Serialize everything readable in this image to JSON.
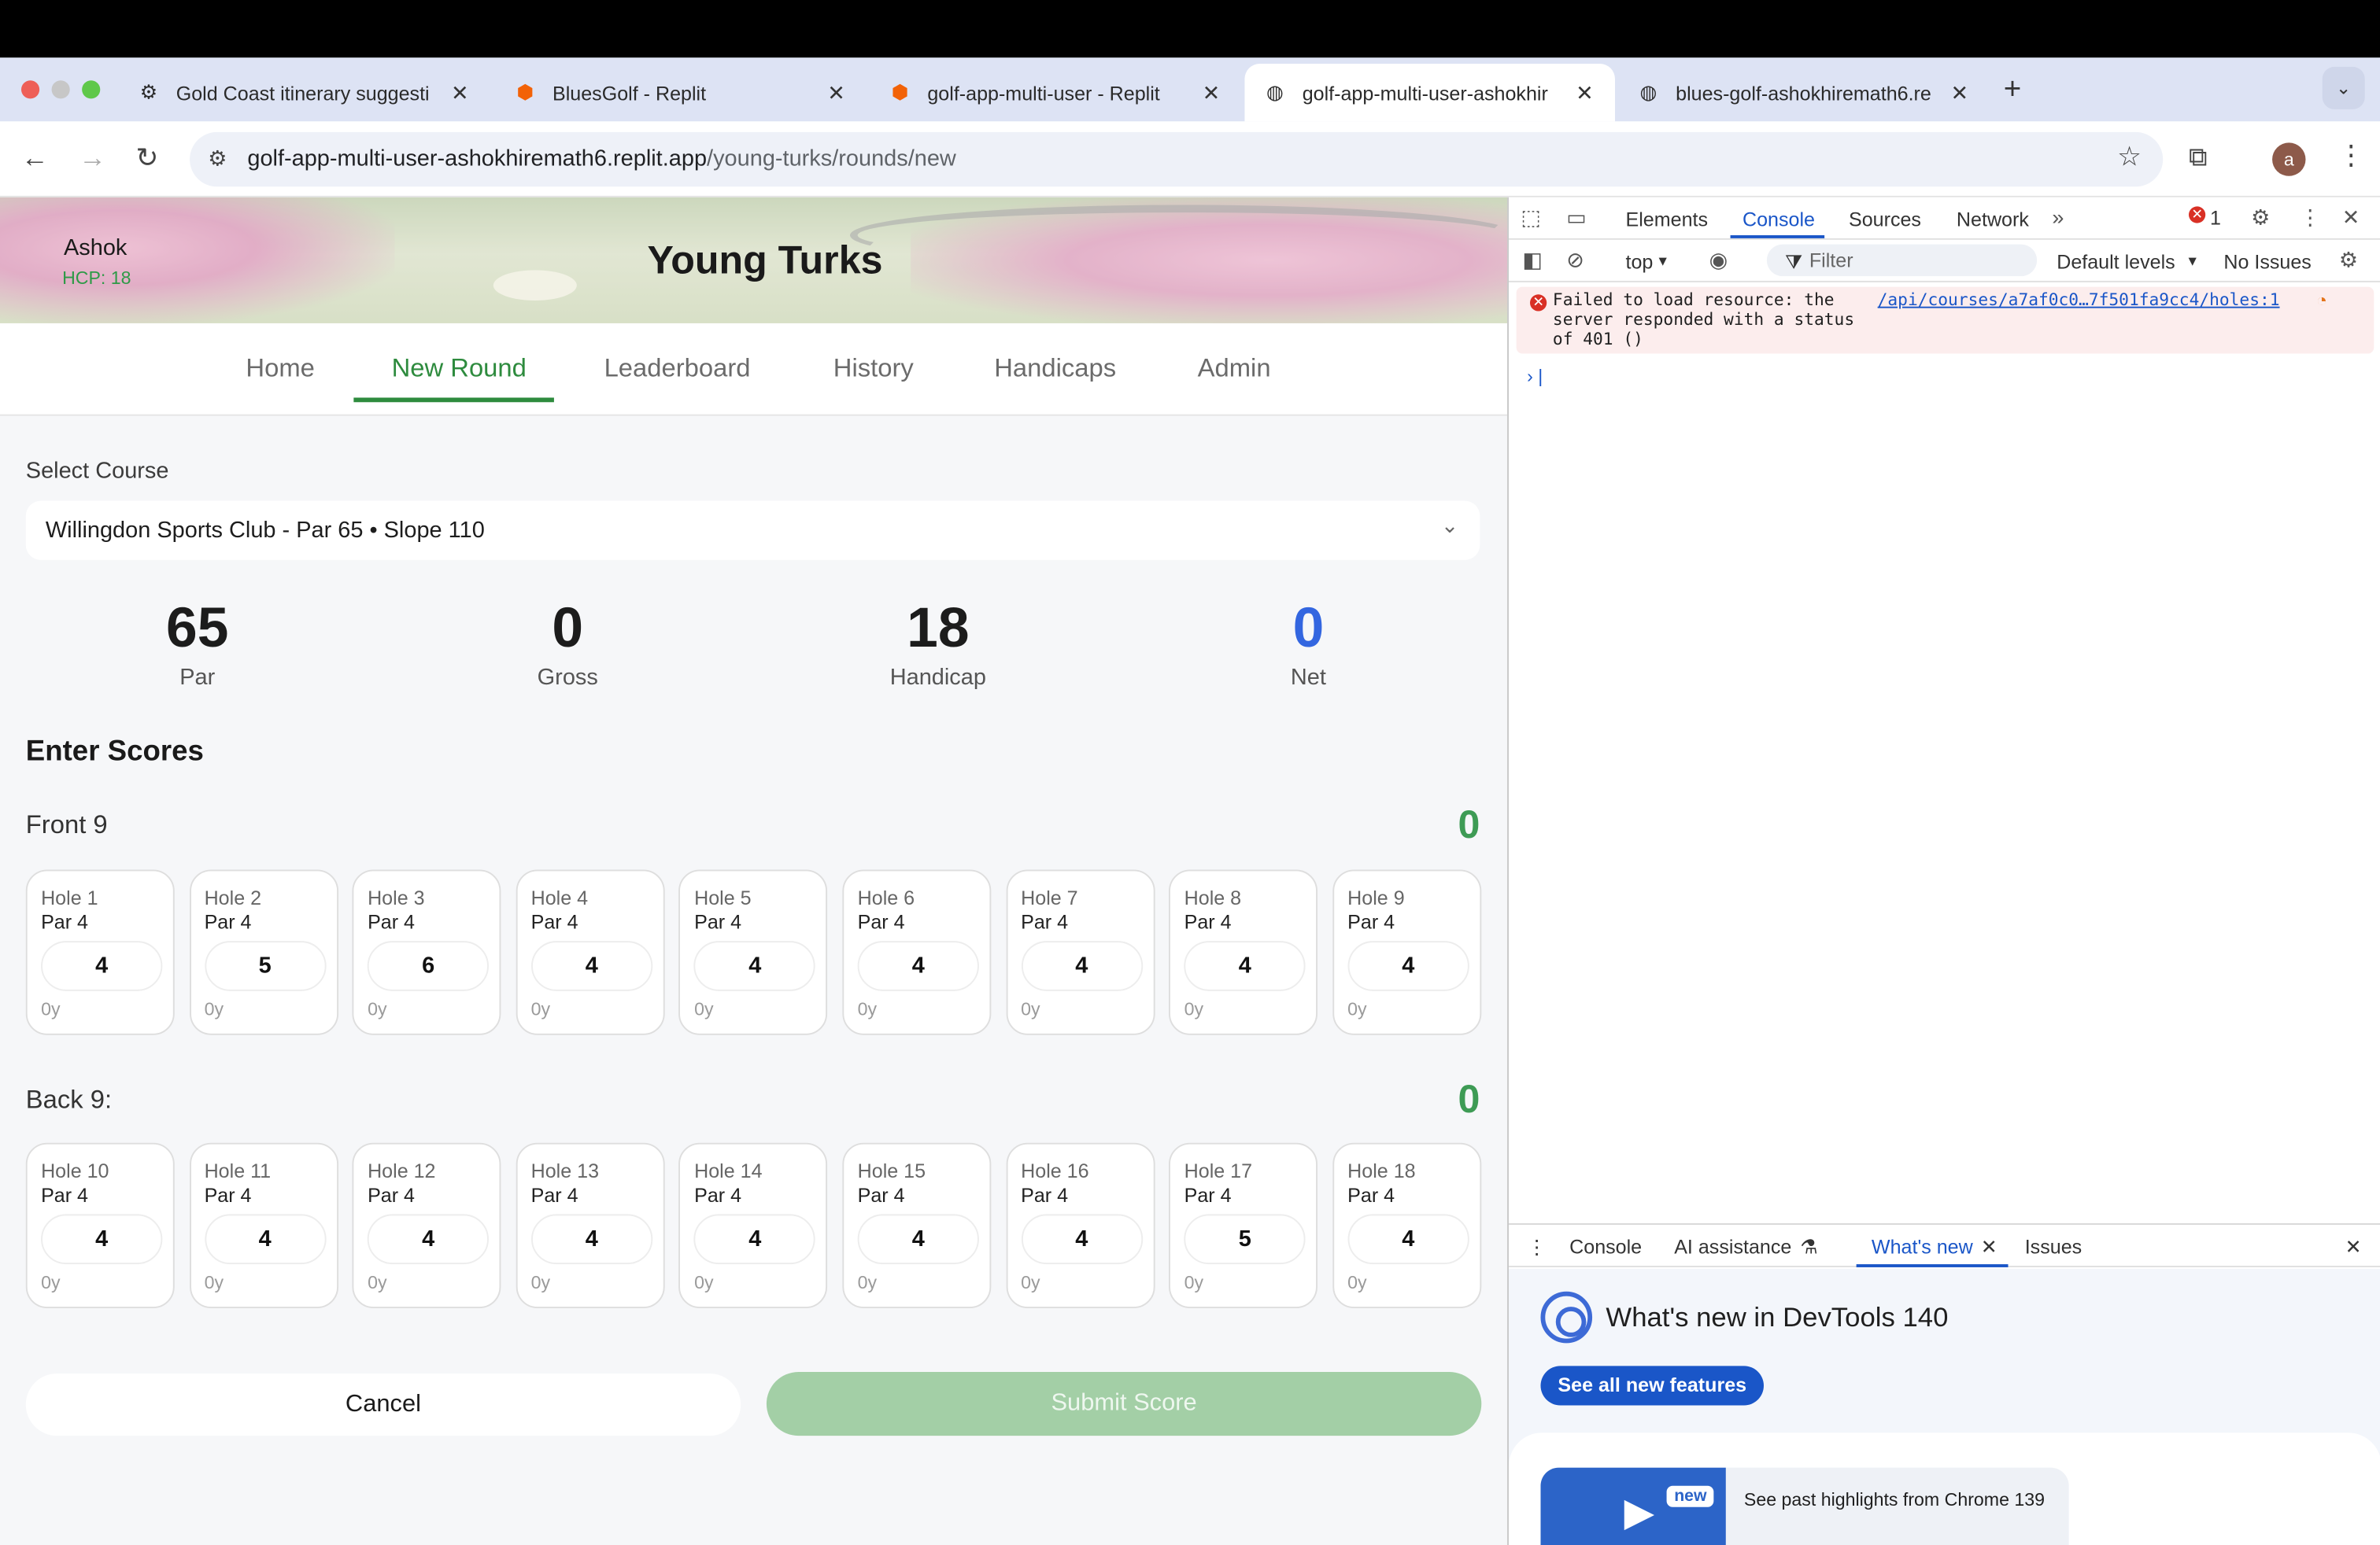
{
  "browser": {
    "tabs": [
      {
        "title": "Gold Coast itinerary suggesti",
        "icon": "openai-icon"
      },
      {
        "title": "BluesGolf - Replit",
        "icon": "replit-icon"
      },
      {
        "title": "golf-app-multi-user - Replit",
        "icon": "replit-icon"
      },
      {
        "title": "golf-app-multi-user-ashokhir",
        "icon": "globe-icon",
        "active": true
      },
      {
        "title": "blues-golf-ashokhiremath6.re",
        "icon": "globe-icon"
      }
    ],
    "url_host": "golf-app-multi-user-ashokhiremath6.replit.app",
    "url_path": "/young-turks/rounds/new",
    "profile_initial": "a"
  },
  "app": {
    "user_name": "Ashok",
    "user_hcp": "HCP: 18",
    "title": "Young Turks",
    "nav": [
      "Home",
      "New Round",
      "Leaderboard",
      "History",
      "Handicaps",
      "Admin"
    ],
    "nav_active": "New Round",
    "select_course_label": "Select Course",
    "course_value": "Willingdon Sports Club - Par 65 • Slope 110",
    "stats": [
      {
        "value": "65",
        "label": "Par"
      },
      {
        "value": "0",
        "label": "Gross"
      },
      {
        "value": "18",
        "label": "Handicap"
      },
      {
        "value": "0",
        "label": "Net"
      }
    ],
    "enter_scores": "Enter Scores",
    "front_title": "Front 9",
    "front_total": "0",
    "back_title": "Back 9:",
    "back_total": "0",
    "front_holes": [
      {
        "hole": "Hole 1",
        "par": "Par 4",
        "score": "4",
        "yards": "0y"
      },
      {
        "hole": "Hole 2",
        "par": "Par 4",
        "score": "5",
        "yards": "0y"
      },
      {
        "hole": "Hole 3",
        "par": "Par 4",
        "score": "6",
        "yards": "0y"
      },
      {
        "hole": "Hole 4",
        "par": "Par 4",
        "score": "4",
        "yards": "0y"
      },
      {
        "hole": "Hole 5",
        "par": "Par 4",
        "score": "4",
        "yards": "0y"
      },
      {
        "hole": "Hole 6",
        "par": "Par 4",
        "score": "4",
        "yards": "0y"
      },
      {
        "hole": "Hole 7",
        "par": "Par 4",
        "score": "4",
        "yards": "0y"
      },
      {
        "hole": "Hole 8",
        "par": "Par 4",
        "score": "4",
        "yards": "0y"
      },
      {
        "hole": "Hole 9",
        "par": "Par 4",
        "score": "4",
        "yards": "0y"
      }
    ],
    "back_holes": [
      {
        "hole": "Hole 10",
        "par": "Par 4",
        "score": "4",
        "yards": "0y"
      },
      {
        "hole": "Hole 11",
        "par": "Par 4",
        "score": "4",
        "yards": "0y"
      },
      {
        "hole": "Hole 12",
        "par": "Par 4",
        "score": "4",
        "yards": "0y"
      },
      {
        "hole": "Hole 13",
        "par": "Par 4",
        "score": "4",
        "yards": "0y"
      },
      {
        "hole": "Hole 14",
        "par": "Par 4",
        "score": "4",
        "yards": "0y"
      },
      {
        "hole": "Hole 15",
        "par": "Par 4",
        "score": "4",
        "yards": "0y"
      },
      {
        "hole": "Hole 16",
        "par": "Par 4",
        "score": "4",
        "yards": "0y"
      },
      {
        "hole": "Hole 17",
        "par": "Par 4",
        "score": "5",
        "yards": "0y"
      },
      {
        "hole": "Hole 18",
        "par": "Par 4",
        "score": "4",
        "yards": "0y"
      }
    ],
    "cancel_label": "Cancel",
    "submit_label": "Submit Score"
  },
  "devtools": {
    "tabs": [
      "Elements",
      "Console",
      "Sources",
      "Network"
    ],
    "active_tab": "Console",
    "error_count": "1",
    "context": "top",
    "filter_placeholder": "Filter",
    "levels": "Default levels",
    "issues": "No Issues",
    "error_message": "Failed to load resource: the server responded with a status of 401 ()",
    "error_link": "/api/courses/a7af0c0…7f501fa9cc4/holes:1",
    "drawer_tabs": [
      "Console",
      "AI assistance",
      "What's new",
      "Issues"
    ],
    "drawer_active": "What's new",
    "whats_new_title": "What's new in DevTools 140",
    "see_all_label": "See all new features",
    "new_badge": "new",
    "highlights_text": "See past highlights from Chrome 139",
    "accent": "#1a56c8"
  }
}
